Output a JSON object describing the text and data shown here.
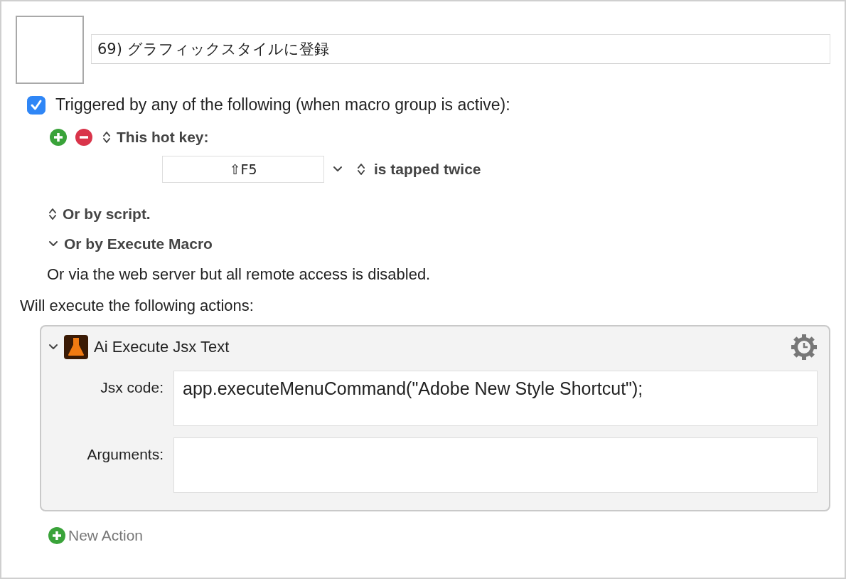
{
  "macro": {
    "name": "69) グラフィックスタイルに登録"
  },
  "trigger": {
    "label": "Triggered by any of the following (when macro group is active):",
    "checked": true
  },
  "hot_key": {
    "label": "This hot key:",
    "key": "⇧F5",
    "mode": "is tapped twice"
  },
  "other_triggers": [
    {
      "kind": "popup",
      "label": "Or by script."
    },
    {
      "kind": "disclosure",
      "label": "Or by Execute Macro"
    }
  ],
  "web_server_note": "Or via the web server but all remote access is disabled.",
  "actions_heading": "Will execute the following actions:",
  "actions": [
    {
      "title": "Ai Execute Jsx Text",
      "expanded": true,
      "fields": [
        {
          "label": "Jsx code:",
          "value": "app.executeMenuCommand(\"Adobe New Style Shortcut\");"
        },
        {
          "label": "Arguments:"
        }
      ]
    }
  ],
  "new_action": "New Action"
}
